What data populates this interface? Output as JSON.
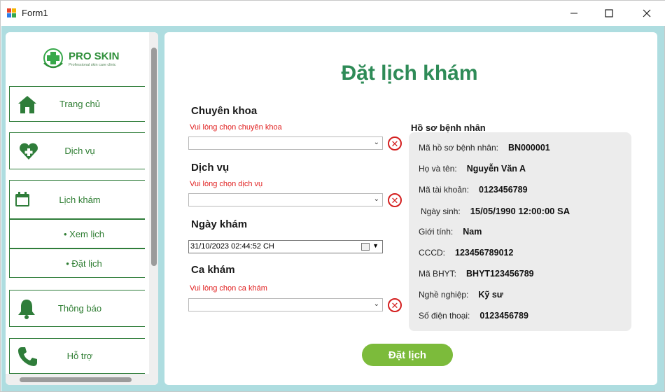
{
  "window": {
    "title": "Form1"
  },
  "sidebar": {
    "logo_title": "PRO SKIN",
    "logo_subtitle": "Professional skin care clinic",
    "items": [
      {
        "label": "Trang chủ",
        "icon": "home-icon"
      },
      {
        "label": "Dịch vụ",
        "icon": "heart-plus-icon"
      },
      {
        "label": "Lịch khám",
        "icon": "calendar-icon"
      },
      {
        "label": "Thông báo",
        "icon": "bell-icon"
      },
      {
        "label": "Hỗ trợ",
        "icon": "phone-icon"
      }
    ],
    "subitems": [
      {
        "label": "• Xem lịch"
      },
      {
        "label": "• Đặt lịch"
      }
    ]
  },
  "main": {
    "title": "Đặt lịch khám",
    "specialty": {
      "label": "Chuyên khoa",
      "error": "Vui lòng chọn chuyên khoa",
      "value": ""
    },
    "service": {
      "label": "Dịch vụ",
      "error": "Vui lòng chọn dịch vụ",
      "value": ""
    },
    "date": {
      "label": "Ngày khám",
      "value": "31/10/2023 02:44:52 CH"
    },
    "shift": {
      "label": "Ca khám",
      "error": "Vui lòng chọn ca khám",
      "value": ""
    },
    "submit_label": "Đặt lịch"
  },
  "profile": {
    "heading": "Hồ sơ bệnh nhân",
    "rows": [
      {
        "label": "Mã hồ sơ bệnh nhân:",
        "value": "BN000001"
      },
      {
        "label": "Họ và tên:",
        "value": "Nguyễn Văn A"
      },
      {
        "label": "Mã tài khoản:",
        "value": "0123456789"
      },
      {
        "label": "Ngày sinh:",
        "value": "15/05/1990 12:00:00 SA"
      },
      {
        "label": "Giới tính:",
        "value": "Nam"
      },
      {
        "label": "CCCD:",
        "value": "123456789012"
      },
      {
        "label": "Mã BHYT:",
        "value": "BHYT123456789"
      },
      {
        "label": "Nghề nghiệp:",
        "value": "Kỹ sư"
      },
      {
        "label": "Số điện thoại:",
        "value": "0123456789"
      }
    ]
  },
  "colors": {
    "accent": "#2e8b57",
    "client_bg": "#aedde0",
    "error": "#e02020",
    "submit_bg": "#7cbb3b"
  }
}
